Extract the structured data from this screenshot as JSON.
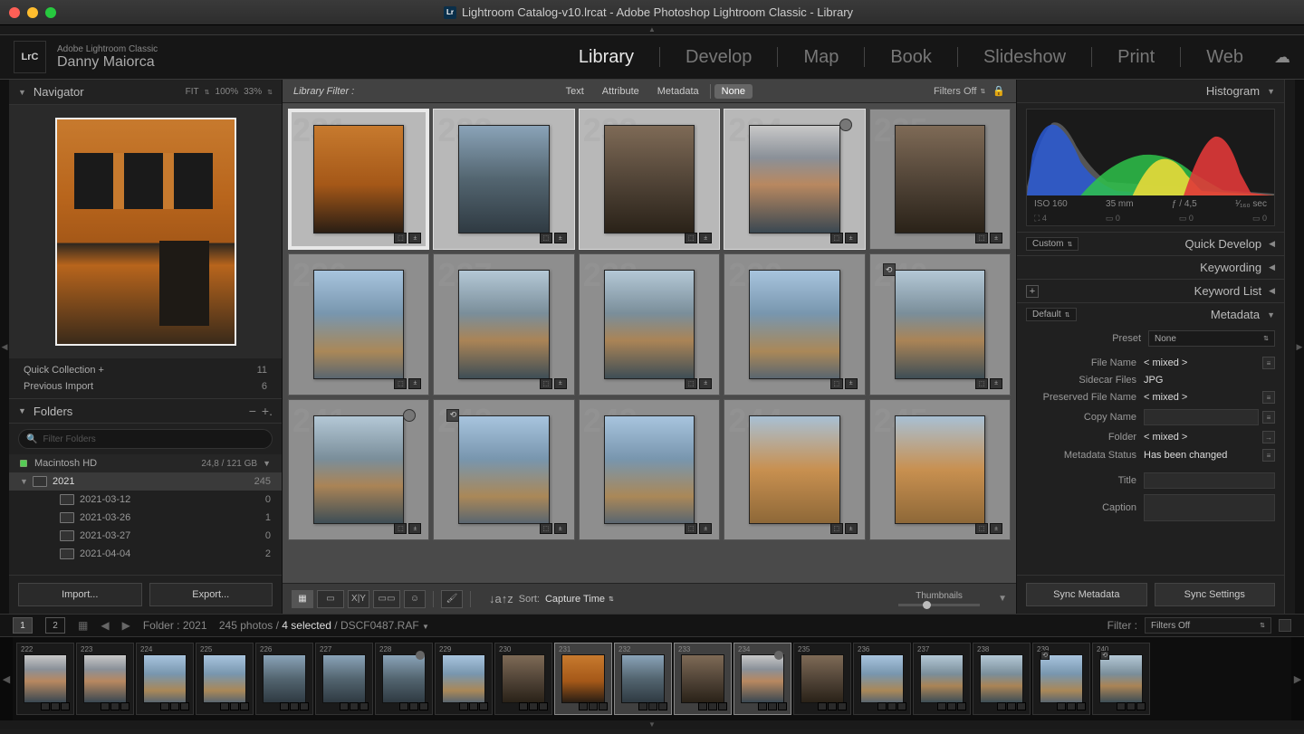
{
  "window_title": "Lightroom Catalog-v10.lrcat - Adobe Photoshop Lightroom Classic - Library",
  "app": {
    "logo_text": "LrC",
    "product": "Adobe Lightroom Classic",
    "user": "Danny Maiorca"
  },
  "modules": [
    "Library",
    "Develop",
    "Map",
    "Book",
    "Slideshow",
    "Print",
    "Web"
  ],
  "active_module": "Library",
  "navigator": {
    "title": "Navigator",
    "zoom": [
      "FIT",
      "100%",
      "33%"
    ]
  },
  "catalog": {
    "quick_collection": {
      "label": "Quick Collection  +",
      "count": "11"
    },
    "previous_import": {
      "label": "Previous Import",
      "count": "6"
    }
  },
  "folders": {
    "title": "Folders",
    "search_placeholder": "Filter Folders",
    "volume": {
      "name": "Macintosh HD",
      "stats": "24,8 / 121 GB"
    },
    "tree": [
      {
        "name": "2021",
        "count": "245",
        "selected": true,
        "expanded": true,
        "indent": 0
      },
      {
        "name": "2021-03-12",
        "count": "0",
        "indent": 1
      },
      {
        "name": "2021-03-26",
        "count": "1",
        "indent": 1
      },
      {
        "name": "2021-03-27",
        "count": "0",
        "indent": 1
      },
      {
        "name": "2021-04-04",
        "count": "2",
        "indent": 1
      }
    ],
    "import_btn": "Import...",
    "export_btn": "Export..."
  },
  "library_filter": {
    "label": "Library Filter :",
    "tabs": [
      "Text",
      "Attribute",
      "Metadata",
      "None"
    ],
    "active_tab": "None",
    "filters_off": "Filters Off"
  },
  "grid": {
    "cells": [
      {
        "num": "231",
        "selected": true,
        "rim": true,
        "variant": "th-orange"
      },
      {
        "num": "232",
        "selected": true,
        "variant": "th-blue"
      },
      {
        "num": "233",
        "selected": true,
        "variant": "th-street"
      },
      {
        "num": "234",
        "selected": true,
        "ring": true,
        "variant": "th-harbor"
      },
      {
        "num": "235",
        "variant": "th-street"
      },
      {
        "num": "236",
        "variant": "th-sky"
      },
      {
        "num": "237",
        "variant": "th-canal"
      },
      {
        "num": "238",
        "variant": "th-canal"
      },
      {
        "num": "239",
        "variant": "th-sky"
      },
      {
        "num": "240",
        "dev": true,
        "variant": "th-canal"
      },
      {
        "num": "241",
        "ring": true,
        "variant": "th-canal"
      },
      {
        "num": "242",
        "dev": true,
        "variant": "th-sky"
      },
      {
        "num": "243",
        "variant": "th-sky"
      },
      {
        "num": "244",
        "variant": "th-autumn"
      },
      {
        "num": "245",
        "variant": "th-autumn"
      }
    ]
  },
  "toolbar": {
    "sort_label": "Sort:",
    "sort_value": "Capture Time",
    "thumbnails_label": "Thumbnails"
  },
  "right": {
    "histogram": {
      "title": "Histogram",
      "iso": "ISO 160",
      "focal": "35 mm",
      "aperture": "ƒ / 4,5",
      "shutter": "¹⁄₁₆₀ sec",
      "crop_count": "4"
    },
    "quick_develop": {
      "title": "Quick Develop",
      "selector": "Custom"
    },
    "keywording": "Keywording",
    "keyword_list": "Keyword List",
    "metadata": {
      "title": "Metadata",
      "selector": "Default",
      "preset_label": "Preset",
      "preset_value": "None",
      "rows": [
        {
          "label": "File Name",
          "value": "< mixed >",
          "icon": true
        },
        {
          "label": "Sidecar Files",
          "value": "JPG"
        },
        {
          "label": "Preserved File Name",
          "value": "< mixed >",
          "icon": true
        },
        {
          "label": "Copy Name",
          "value": "",
          "input": true,
          "icon": true
        },
        {
          "label": "Folder",
          "value": "< mixed >",
          "icon": "arrow"
        },
        {
          "label": "Metadata Status",
          "value": "Has been changed",
          "icon": true
        }
      ],
      "title_label": "Title",
      "caption_label": "Caption"
    },
    "sync_metadata": "Sync Metadata",
    "sync_settings": "Sync Settings"
  },
  "status": {
    "view1": "1",
    "view2": "2",
    "folder_label": "Folder : 2021",
    "photos": "245 photos / ",
    "selected": "4 selected",
    "filename": " / DSCF0487.RAF",
    "filter_label": "Filter :",
    "filter_value": "Filters Off"
  },
  "filmstrip": [
    {
      "num": "222",
      "variant": "th-harbor"
    },
    {
      "num": "223",
      "variant": "th-harbor"
    },
    {
      "num": "224",
      "variant": "th-sky"
    },
    {
      "num": "225",
      "variant": "th-sky"
    },
    {
      "num": "226",
      "variant": "th-blue"
    },
    {
      "num": "227",
      "variant": "th-blue"
    },
    {
      "num": "228",
      "ring": true,
      "variant": "th-blue"
    },
    {
      "num": "229",
      "variant": "th-sky"
    },
    {
      "num": "230",
      "variant": "th-street"
    },
    {
      "num": "231",
      "sel": true,
      "variant": "th-orange"
    },
    {
      "num": "232",
      "sel": true,
      "variant": "th-blue"
    },
    {
      "num": "233",
      "sel": true,
      "variant": "th-street"
    },
    {
      "num": "234",
      "sel": true,
      "ring": true,
      "variant": "th-harbor"
    },
    {
      "num": "235",
      "variant": "th-street"
    },
    {
      "num": "236",
      "variant": "th-sky"
    },
    {
      "num": "237",
      "variant": "th-canal"
    },
    {
      "num": "238",
      "variant": "th-canal"
    },
    {
      "num": "239",
      "dev": true,
      "variant": "th-sky"
    },
    {
      "num": "240",
      "dev": true,
      "variant": "th-canal"
    }
  ]
}
